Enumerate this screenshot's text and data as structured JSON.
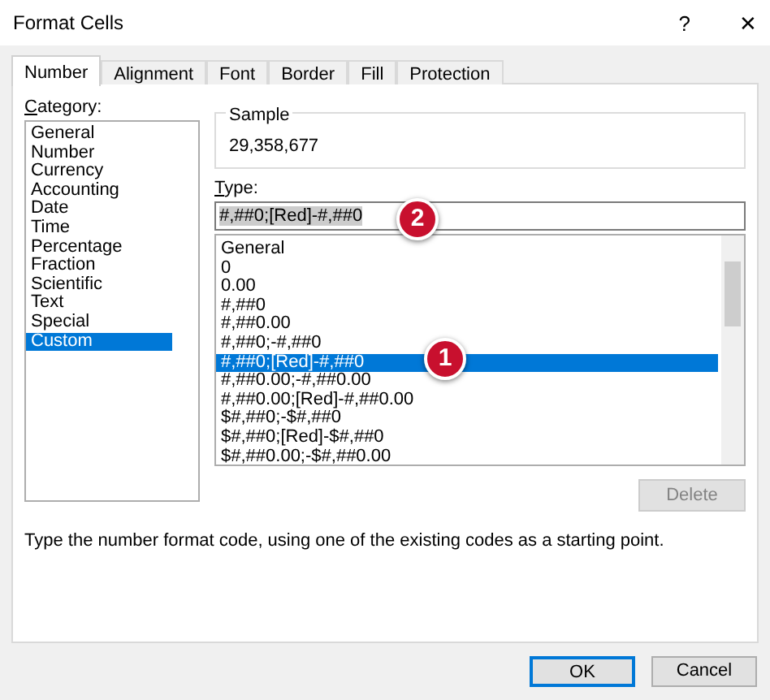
{
  "window": {
    "title": "Format Cells",
    "help": "?",
    "close": "✕"
  },
  "tabs": [
    {
      "label": "Number",
      "selected": true
    },
    {
      "label": "Alignment",
      "selected": false
    },
    {
      "label": "Font",
      "selected": false
    },
    {
      "label": "Border",
      "selected": false
    },
    {
      "label": "Fill",
      "selected": false
    },
    {
      "label": "Protection",
      "selected": false
    }
  ],
  "category": {
    "label": "Category:",
    "items": [
      {
        "label": "General",
        "selected": false
      },
      {
        "label": "Number",
        "selected": false
      },
      {
        "label": "Currency",
        "selected": false
      },
      {
        "label": "Accounting",
        "selected": false
      },
      {
        "label": "Date",
        "selected": false
      },
      {
        "label": "Time",
        "selected": false
      },
      {
        "label": "Percentage",
        "selected": false
      },
      {
        "label": "Fraction",
        "selected": false
      },
      {
        "label": "Scientific",
        "selected": false
      },
      {
        "label": "Text",
        "selected": false
      },
      {
        "label": "Special",
        "selected": false
      },
      {
        "label": "Custom",
        "selected": true
      }
    ]
  },
  "sample": {
    "label": "Sample",
    "value": "29,358,677"
  },
  "type": {
    "label": "Type:",
    "value": "#,##0;[Red]-#,##0",
    "text_selected": true
  },
  "formats": [
    {
      "label": "General",
      "selected": false
    },
    {
      "label": "0",
      "selected": false
    },
    {
      "label": "0.00",
      "selected": false
    },
    {
      "label": "#,##0",
      "selected": false
    },
    {
      "label": "#,##0.00",
      "selected": false
    },
    {
      "label": "#,##0;-#,##0",
      "selected": false
    },
    {
      "label": "#,##0;[Red]-#,##0",
      "selected": true
    },
    {
      "label": "#,##0.00;-#,##0.00",
      "selected": false
    },
    {
      "label": "#,##0.00;[Red]-#,##0.00",
      "selected": false
    },
    {
      "label": "$#,##0;-$#,##0",
      "selected": false
    },
    {
      "label": "$#,##0;[Red]-$#,##0",
      "selected": false
    },
    {
      "label": "$#,##0.00;-$#,##0.00",
      "selected": false
    }
  ],
  "delete_button": {
    "label": "Delete",
    "disabled": true
  },
  "description": "Type the number format code, using one of the existing codes as a starting point.",
  "callouts": [
    {
      "label": "2"
    },
    {
      "label": "1"
    }
  ],
  "buttons": [
    {
      "label": "OK",
      "default": true
    },
    {
      "label": "Cancel",
      "default": false
    }
  ]
}
